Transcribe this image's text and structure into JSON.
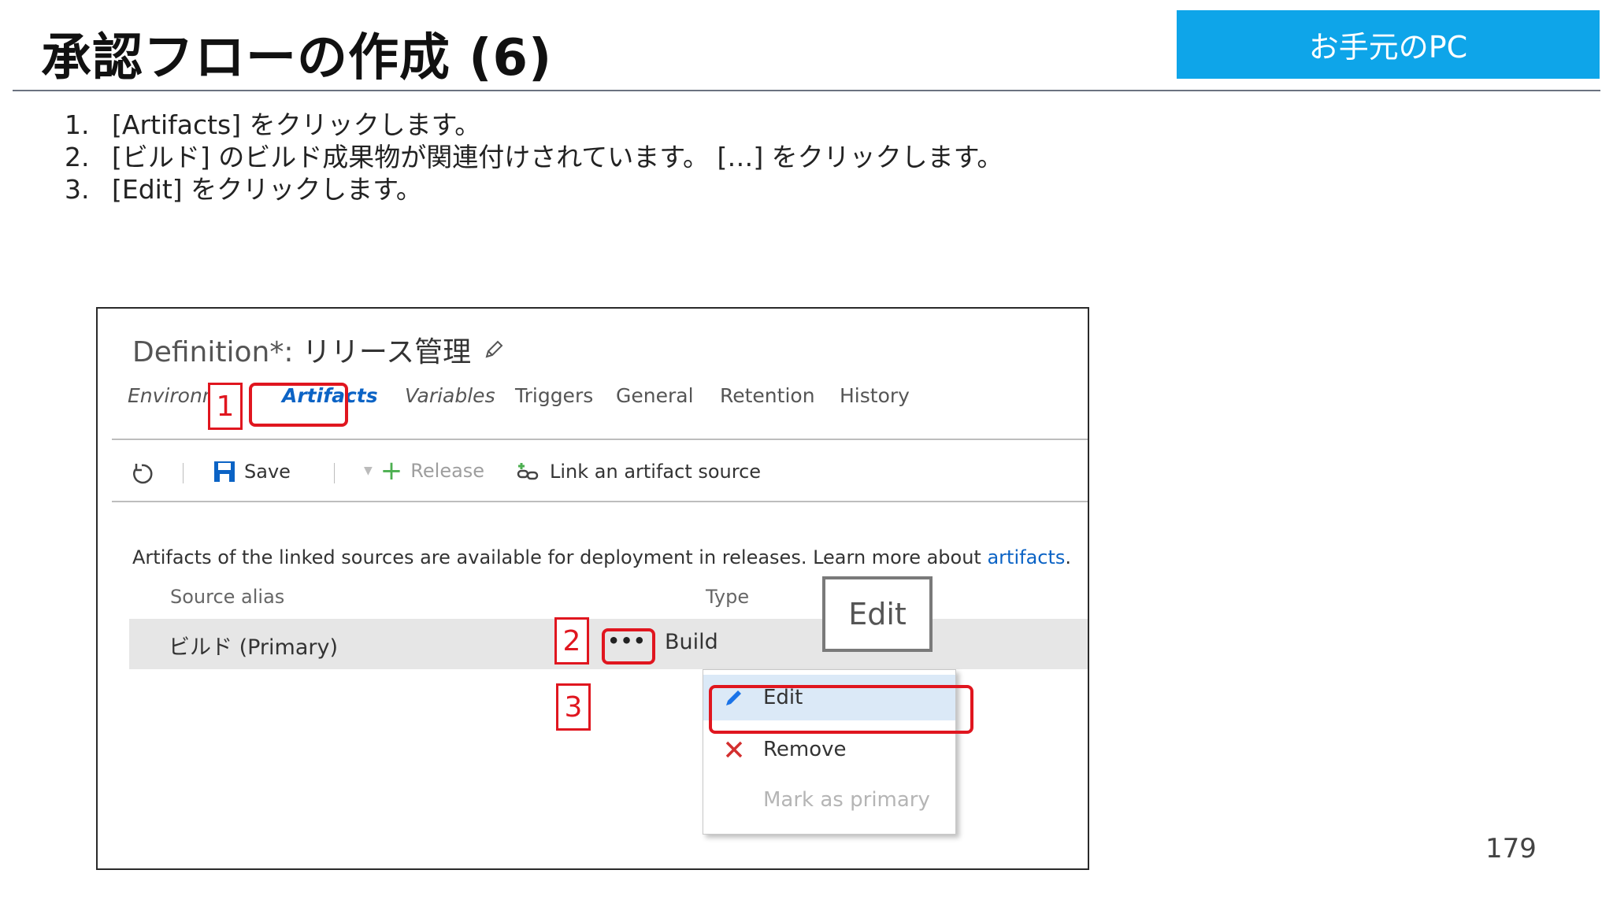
{
  "slide": {
    "title": "承認フローの作成 (6)",
    "badge": "お手元のPC",
    "steps": [
      {
        "num": "1.",
        "text": "[Artifacts] をクリックします。"
      },
      {
        "num": "2.",
        "text": "[ビルド] のビルド成果物が関連付けされています。 […] をクリックします。"
      },
      {
        "num": "3.",
        "text": "[Edit] をクリックします。"
      }
    ],
    "page_number": "179"
  },
  "screenshot": {
    "definition_label": "Definition*:",
    "definition_name": "リリース管理",
    "tabs": [
      "Environm",
      "Artifacts",
      "Variables",
      "Triggers",
      "General",
      "Retention",
      "History"
    ],
    "toolbar": {
      "save": "Save",
      "release": "Release",
      "link": "Link an artifact source"
    },
    "info_text": "Artifacts of the linked sources are available for deployment in releases. Learn more about ",
    "info_link": "artifacts",
    "info_end": ".",
    "columns": {
      "source_alias": "Source alias",
      "type": "Type"
    },
    "row": {
      "alias": "ビルド (Primary)",
      "more": "•••",
      "type": "Build"
    },
    "menu": {
      "edit": "Edit",
      "remove": "Remove",
      "mark_primary": "Mark as primary"
    },
    "edit_tooltip": "Edit",
    "callouts": [
      "1",
      "2",
      "3"
    ]
  },
  "colors": {
    "accent": "#0ea5e9",
    "callout": "#e0161f",
    "link": "#0b63c5"
  }
}
